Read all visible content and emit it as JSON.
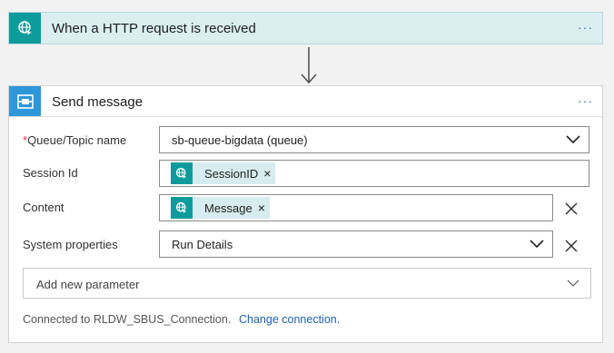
{
  "trigger": {
    "title": "When a HTTP request is received",
    "icon": "globe-request-icon",
    "menu": "···"
  },
  "action": {
    "title": "Send message",
    "icon": "service-bus-icon",
    "menu": "···",
    "fields": {
      "queue": {
        "label": "Queue/Topic name",
        "required_mark": "*",
        "value": "sb-queue-bigdata (queue)"
      },
      "session": {
        "label": "Session Id",
        "token": "SessionID",
        "token_remove": "×"
      },
      "content": {
        "label": "Content",
        "token": "Message",
        "token_remove": "×"
      },
      "system_properties": {
        "label": "System properties",
        "value": "Run Details"
      }
    },
    "add_parameter": "Add new parameter",
    "connection_text": "Connected to RLDW_SBUS_Connection.",
    "change_connection": "Change connection."
  },
  "colors": {
    "teal": "#0e9b9b",
    "service_bus_blue": "#2e97d9",
    "link_blue": "#1b62b1",
    "trigger_bg": "#dbeff1",
    "token_bg": "#d6ecee"
  }
}
